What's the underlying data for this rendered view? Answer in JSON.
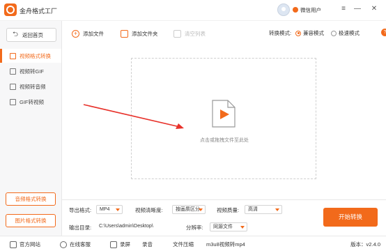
{
  "app": {
    "title": "金舟格式工厂",
    "user_label": "微信用户"
  },
  "window": {
    "menu_icon": "≡",
    "minimize_icon": "—",
    "close_icon": "✕"
  },
  "sidebar": {
    "back_label": "返回首页",
    "items": [
      {
        "label": "视频格式转换",
        "active": true
      },
      {
        "label": "视频转GIF",
        "active": false
      },
      {
        "label": "视频转音频",
        "active": false
      },
      {
        "label": "GIF转视频",
        "active": false
      }
    ],
    "bottom_buttons": [
      "音频格式转换",
      "图片格式转换"
    ]
  },
  "toolbar": {
    "add_file": "添加文件",
    "add_folder": "添加文件夹",
    "clear_list": "清空列表",
    "mode_label": "转换模式:",
    "mode_compatible": "兼容模式",
    "mode_fast": "极速模式",
    "help": "?"
  },
  "drop_area": {
    "hint": "点击或拖拽文件至此处"
  },
  "settings": {
    "export_format_label": "导出格式:",
    "export_format_value": "MP4",
    "clarity_label": "视频清晰度:",
    "clarity_value": "按画质区分",
    "quality_label": "视频质量:",
    "quality_value": "高清",
    "output_dir_label": "输出目录:",
    "output_dir_value": "C:\\Users\\admin\\Desktop\\",
    "output_dir_more": "•••",
    "resolution_label": "分辨率:",
    "resolution_value": "同源文件",
    "start_button": "开始转换"
  },
  "footer": {
    "website": "官方网站",
    "support": "在线客服",
    "links": [
      "录屏",
      "录音",
      "文件压缩",
      "m3u8视频转mp4"
    ],
    "version": "版本：v2.4.0"
  },
  "colors": {
    "accent": "#f26a1b"
  }
}
